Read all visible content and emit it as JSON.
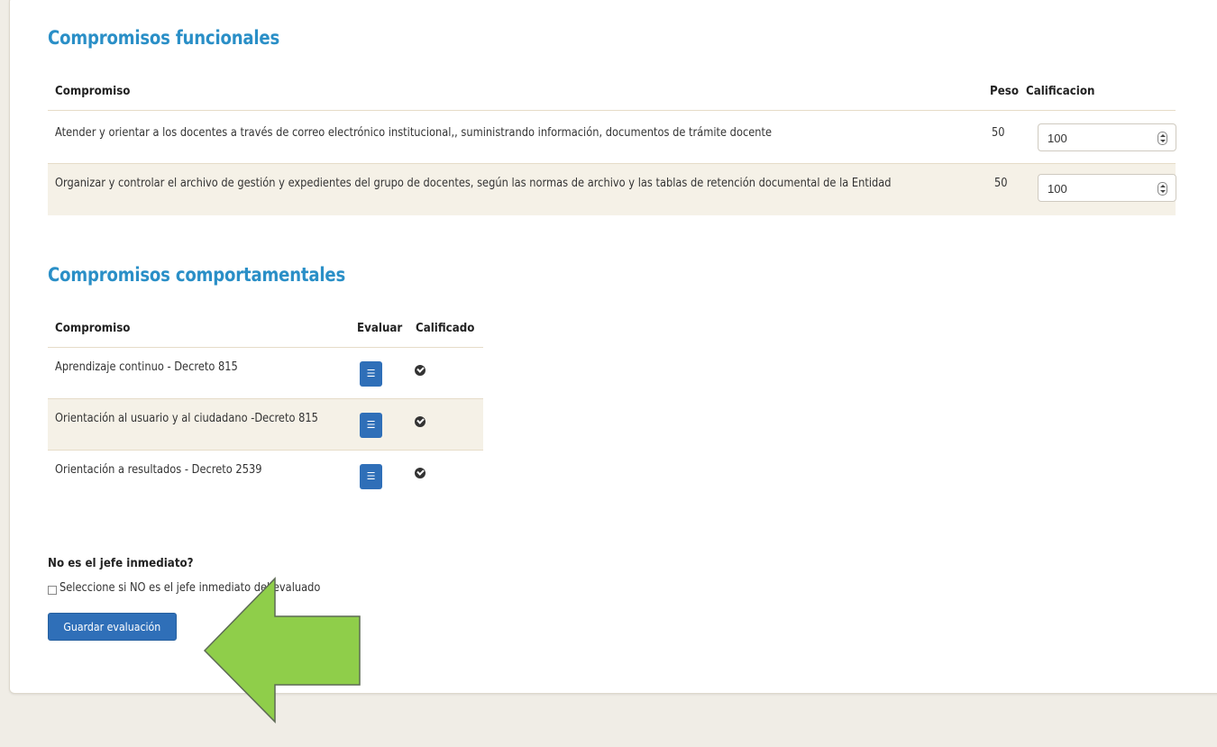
{
  "functional": {
    "title": "Compromisos funcionales",
    "headers": {
      "commitment": "Compromiso",
      "weight": "Peso",
      "rating": "Calificacion"
    },
    "rows": [
      {
        "text": "Atender y orientar a los docentes a través de correo electrónico institucional,, suministrando información, documentos de trámite docente",
        "weight": "50",
        "rating": "100"
      },
      {
        "text": "Organizar y controlar el archivo de gestión y expedientes del grupo de docentes, según las normas de archivo y las tablas de retención documental de la Entidad",
        "weight": "50",
        "rating": "100"
      }
    ]
  },
  "behavioral": {
    "title": "Compromisos comportamentales",
    "headers": {
      "commitment": "Compromiso",
      "evaluate": "Evaluar",
      "rated": "Calificado"
    },
    "rows": [
      {
        "text": "Aprendizaje continuo - Decreto 815",
        "eval_icon": "list-check-icon",
        "rated_icon": "check-circle-icon"
      },
      {
        "text": "Orientación al usuario y al ciudadano -Decreto 815",
        "eval_icon": "list-check-icon",
        "rated_icon": "check-circle-icon"
      },
      {
        "text": "Orientación a resultados - Decreto 2539",
        "eval_icon": "list-check-icon",
        "rated_icon": "check-circle-icon"
      }
    ]
  },
  "supervisor": {
    "question": "No es el jefe inmediato?",
    "checkbox_label": "Seleccione si NO es el jefe inmediato del evaluado",
    "checked": false
  },
  "actions": {
    "save_label": "Guardar evaluación"
  },
  "colors": {
    "accent": "#2a8fc7",
    "button": "#2f6fb8",
    "row_alt": "#f5f1e7",
    "page_bg": "#f0ede6",
    "annotation_arrow": "#8fce4a"
  }
}
